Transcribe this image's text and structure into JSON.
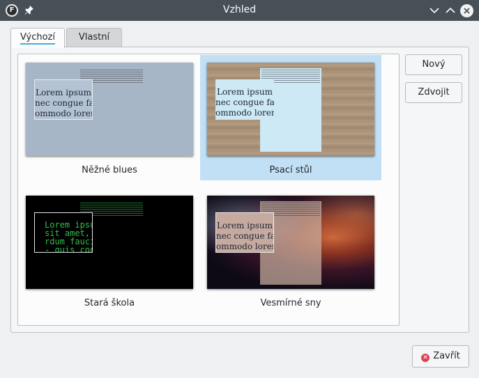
{
  "window": {
    "title": "Vzhled",
    "app_icon_letter": "F"
  },
  "tabs": [
    {
      "label": "Výchozí",
      "active": true
    },
    {
      "label": "Vlastní",
      "active": false
    }
  ],
  "themes": [
    {
      "name": "Něžné blues",
      "selected": false,
      "lines": [
        "Lorem ipsum",
        "nec congue faci",
        "ommodo lorem."
      ]
    },
    {
      "name": "Psací stůl",
      "selected": true,
      "lines": [
        "Lorem ipsum",
        "nec congue faci",
        "ommodo lorem."
      ]
    },
    {
      "name": "Stará škola",
      "selected": false,
      "lines": [
        "Lorem ipsum",
        "sit amet, c",
        "rdum faucib",
        "- quis con"
      ]
    },
    {
      "name": "Vesmírné sny",
      "selected": false,
      "lines": [
        "Lorem ipsum",
        "nec congue faci",
        "ommodo lorem."
      ]
    }
  ],
  "buttons": {
    "new_label": "Nový",
    "duplicate_label": "Zdvojit",
    "close_label": "Zavřít"
  },
  "icons": {
    "app": "focuswriter-app-icon",
    "pin": "pin-icon",
    "minimize": "chevron-down-icon",
    "maximize": "chevron-up-icon",
    "close": "close-icon",
    "close_button": "close-circle-icon"
  },
  "colors": {
    "titlebar": "#475057",
    "selection": "#c2e0f5",
    "tab_underline": "#3daee9",
    "close_red": "#da4453",
    "blues_bg": "#a7b6c7",
    "oldschool_text": "#2fbf47"
  }
}
